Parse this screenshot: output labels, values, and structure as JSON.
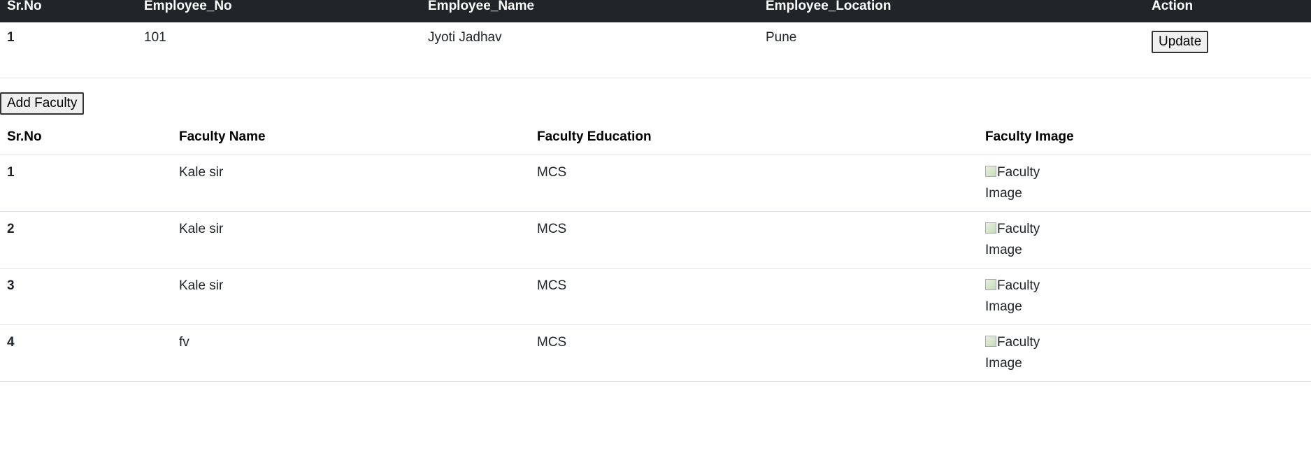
{
  "employee_table": {
    "headers": [
      "Sr.No",
      "Employee_No",
      "Employee_Name",
      "Employee_Location",
      "Action"
    ],
    "rows": [
      {
        "srno": "1",
        "employee_no": "101",
        "employee_name": "Jyoti Jadhav",
        "employee_location": "Pune",
        "action_label": "Update"
      }
    ]
  },
  "add_faculty_label": "Add Faculty",
  "faculty_table": {
    "headers": [
      "Sr.No",
      "Faculty Name",
      "Faculty Education",
      "Faculty Image"
    ],
    "rows": [
      {
        "srno": "1",
        "name": "Kale sir",
        "education": "MCS",
        "image_alt": "Faculty Image",
        "image_icon": "broken-image-icon"
      },
      {
        "srno": "2",
        "name": "Kale sir",
        "education": "MCS",
        "image_alt": "Faculty Image",
        "image_icon": "broken-image-icon"
      },
      {
        "srno": "3",
        "name": "Kale sir",
        "education": "MCS",
        "image_alt": "Faculty Image",
        "image_icon": "broken-image-icon"
      },
      {
        "srno": "4",
        "name": "fv",
        "education": "MCS",
        "image_alt": "Faculty Image",
        "image_icon": "broken-image-icon"
      }
    ]
  },
  "colors": {
    "header_bg": "#212529",
    "header_text": "#ffffff",
    "row_border": "#dee2e6"
  }
}
